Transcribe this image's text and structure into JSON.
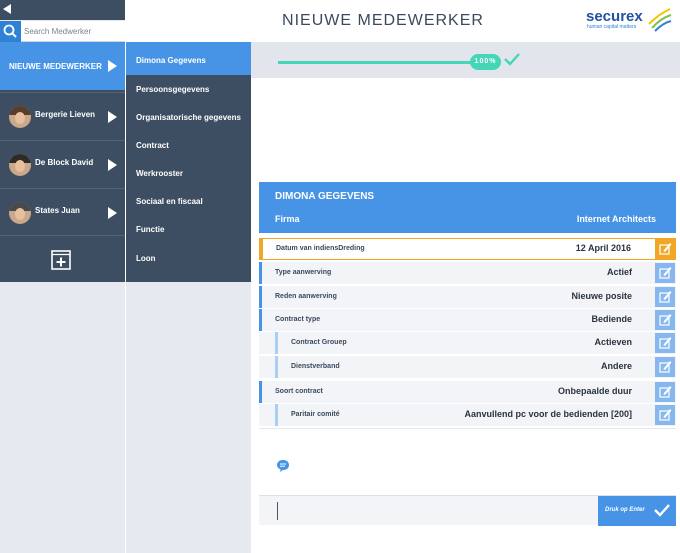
{
  "search": {
    "placeholder": "Search Medwerker"
  },
  "team": {
    "new_employee_label": "NIEUWE MEDEWERKER",
    "employees": [
      {
        "name": "Bergerie Lieven"
      },
      {
        "name": "De Block David"
      },
      {
        "name": "States Juan"
      }
    ]
  },
  "nav": {
    "items": [
      {
        "label": "Dimona Gegevens"
      },
      {
        "label": "Persoonsgegevens"
      },
      {
        "label": "Organisatorische gegevens"
      },
      {
        "label": "Contract"
      },
      {
        "label": "Werkrooster"
      },
      {
        "label": "Sociaal en fiscaal"
      },
      {
        "label": "Functie"
      },
      {
        "label": "Loon"
      }
    ]
  },
  "header": {
    "title": "NIEUWE MEDEWERKER",
    "logo_word": "securex",
    "logo_tagline": "human capital matters"
  },
  "progress": {
    "label": "100%",
    "fraction": 1.0
  },
  "panel": {
    "title": "DIMONA GEGEVENS",
    "firma_label": "Firma",
    "firma_value": "Internet Architects",
    "rows": [
      {
        "label": "Datum van indiensDreding",
        "value": "12 April 2016"
      },
      {
        "label": "Type aanwerving",
        "value": "Actief"
      },
      {
        "label": "Reden aanwerving",
        "value": "Nieuwe posite"
      },
      {
        "label": "Contract type",
        "value": "Bediende"
      },
      {
        "label": "Contract Grouep",
        "value": "Actieven"
      },
      {
        "label": "Dienstverband",
        "value": "Andere"
      },
      {
        "label": "Soort contract",
        "value": "Onbepaalde duur"
      },
      {
        "label": "Paritair comité",
        "value": "Aanvullend pc voor de bedienden [200]"
      }
    ]
  },
  "input": {
    "value": "",
    "button_label": "Druk op Enter"
  },
  "colors": {
    "dark_nav": "#3d4e63",
    "accent_blue": "#4794e6",
    "highlight_orange": "#f2a625",
    "progress_green": "#44d6b7"
  }
}
